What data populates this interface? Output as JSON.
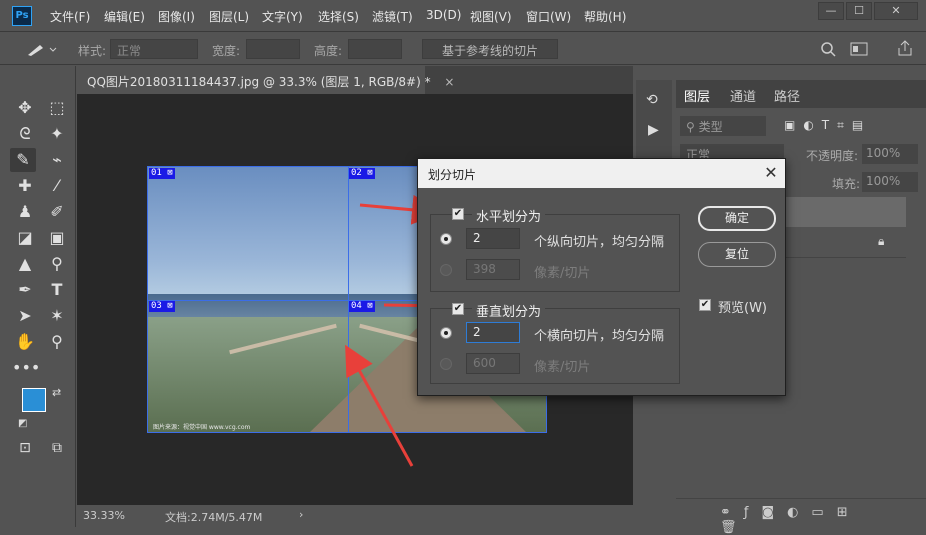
{
  "app": {
    "logo": "Ps"
  },
  "menu": [
    "文件(F)",
    "编辑(E)",
    "图像(I)",
    "图层(L)",
    "文字(Y)",
    "选择(S)",
    "滤镜(T)",
    "3D(D)",
    "视图(V)",
    "窗口(W)",
    "帮助(H)"
  ],
  "window_controls": {
    "minimize": "—",
    "maximize": "☐",
    "close": "✕"
  },
  "options_bar": {
    "style_label": "样式:",
    "style_value": "正常",
    "width_label": "宽度:",
    "height_label": "高度:",
    "slices_button": "基于参考线的切片"
  },
  "document": {
    "tab_title": "QQ图片20180311184437.jpg @ 33.3% (图层 1, RGB/8#) *",
    "tab_close": "×",
    "status_zoom": "33.33%",
    "status_doc": "文档:2.74M/5.47M",
    "status_arrow": "›",
    "slices": [
      "01",
      "02",
      "03",
      "04"
    ],
    "watermark": "图片来源：视觉中国 www.vcg.com"
  },
  "right_panel": {
    "tabs": [
      "图层",
      "通道",
      "路径"
    ],
    "filter_label": "类型",
    "blend_mode": "正常",
    "opacity_label": "不透明度:",
    "opacity_value": "100%",
    "fill_label": "填充:",
    "fill_value": "100%"
  },
  "dialog": {
    "title": "划分切片",
    "close": "✕",
    "horizontal": {
      "checkbox_label": "水平划分为",
      "checked": true,
      "count_value": "2",
      "count_label": "个纵向切片，均匀分隔",
      "pixels_value": "398",
      "pixels_label": "像素/切片"
    },
    "vertical": {
      "checkbox_label": "垂直划分为",
      "checked": true,
      "count_value": "2",
      "count_label": "个横向切片，均匀分隔",
      "pixels_value": "600",
      "pixels_label": "像素/切片"
    },
    "ok_button": "确定",
    "reset_button": "复位",
    "preview_label": "预览(W)",
    "preview_checked": true
  },
  "colors": {
    "annotation_arrow": "#e8403a",
    "slice_line": "#3b6de8",
    "foreground": "#2a8fd6",
    "background": "#2a8fd6"
  }
}
